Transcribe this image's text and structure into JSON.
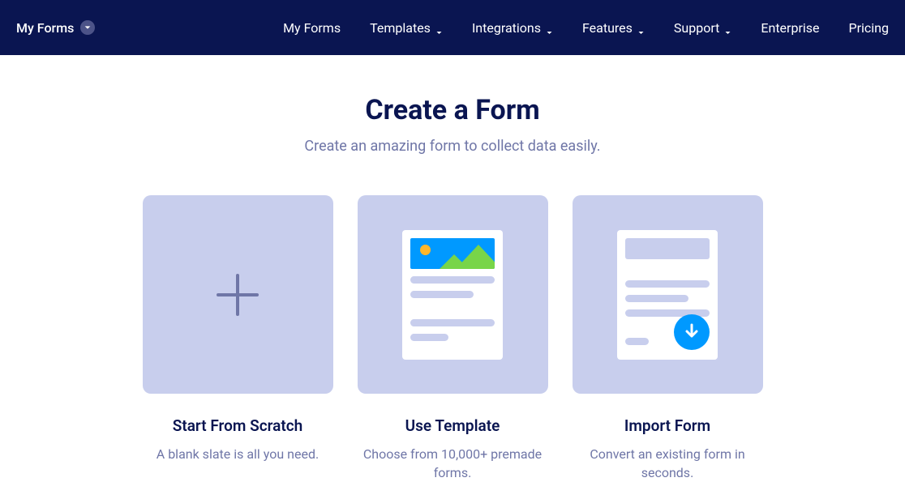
{
  "navbar": {
    "current": "My Forms",
    "items": [
      {
        "label": "My Forms",
        "hasDropdown": false
      },
      {
        "label": "Templates",
        "hasDropdown": true
      },
      {
        "label": "Integrations",
        "hasDropdown": true
      },
      {
        "label": "Features",
        "hasDropdown": true
      },
      {
        "label": "Support",
        "hasDropdown": true
      },
      {
        "label": "Enterprise",
        "hasDropdown": false
      },
      {
        "label": "Pricing",
        "hasDropdown": false
      }
    ]
  },
  "page": {
    "title": "Create a Form",
    "subtitle": "Create an amazing form to collect data easily."
  },
  "cards": {
    "scratch": {
      "title": "Start From Scratch",
      "description": "A blank slate is all you need."
    },
    "template": {
      "title": "Use Template",
      "description": "Choose from 10,000+ premade forms."
    },
    "import": {
      "title": "Import Form",
      "description": "Convert an existing form in seconds."
    }
  }
}
